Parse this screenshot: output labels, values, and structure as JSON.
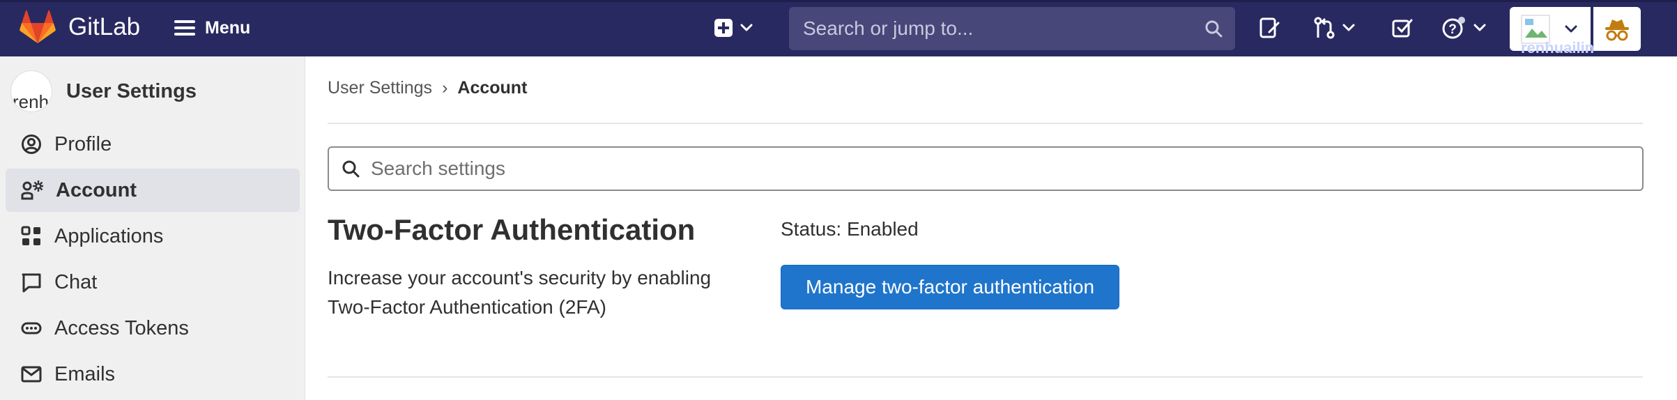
{
  "app": {
    "brand_name": "GitLab"
  },
  "topbar": {
    "menu_label": "Menu",
    "search_placeholder": "Search or jump to...",
    "user_name": "renhuailin",
    "icons": [
      "plus-square-icon",
      "chevron-down-icon",
      "search-icon",
      "issues-icon",
      "merge-request-icon",
      "todo-icon",
      "help-icon",
      "avatar",
      "impersonation-icon"
    ],
    "colors": {
      "bar": "#292961",
      "search_bg": "#47477a"
    }
  },
  "sidebar": {
    "context_title": "User Settings",
    "avatar_alt": "renh",
    "items": [
      {
        "label": "Profile",
        "icon": "profile-icon"
      },
      {
        "label": "Account",
        "icon": "account-icon",
        "active": true
      },
      {
        "label": "Applications",
        "icon": "applications-icon"
      },
      {
        "label": "Chat",
        "icon": "chat-icon"
      },
      {
        "label": "Access Tokens",
        "icon": "token-icon"
      },
      {
        "label": "Emails",
        "icon": "mail-icon"
      }
    ]
  },
  "breadcrumb": {
    "parent": "User Settings",
    "separator": "›",
    "current": "Account"
  },
  "settings_search": {
    "placeholder": "Search settings"
  },
  "two_factor": {
    "title": "Two-Factor Authentication",
    "description": "Increase your account's security by enabling Two-Factor Authentication (2FA)",
    "status": "Status: Enabled",
    "button_label": "Manage two-factor authentication",
    "button_color": "#1f75cb"
  }
}
